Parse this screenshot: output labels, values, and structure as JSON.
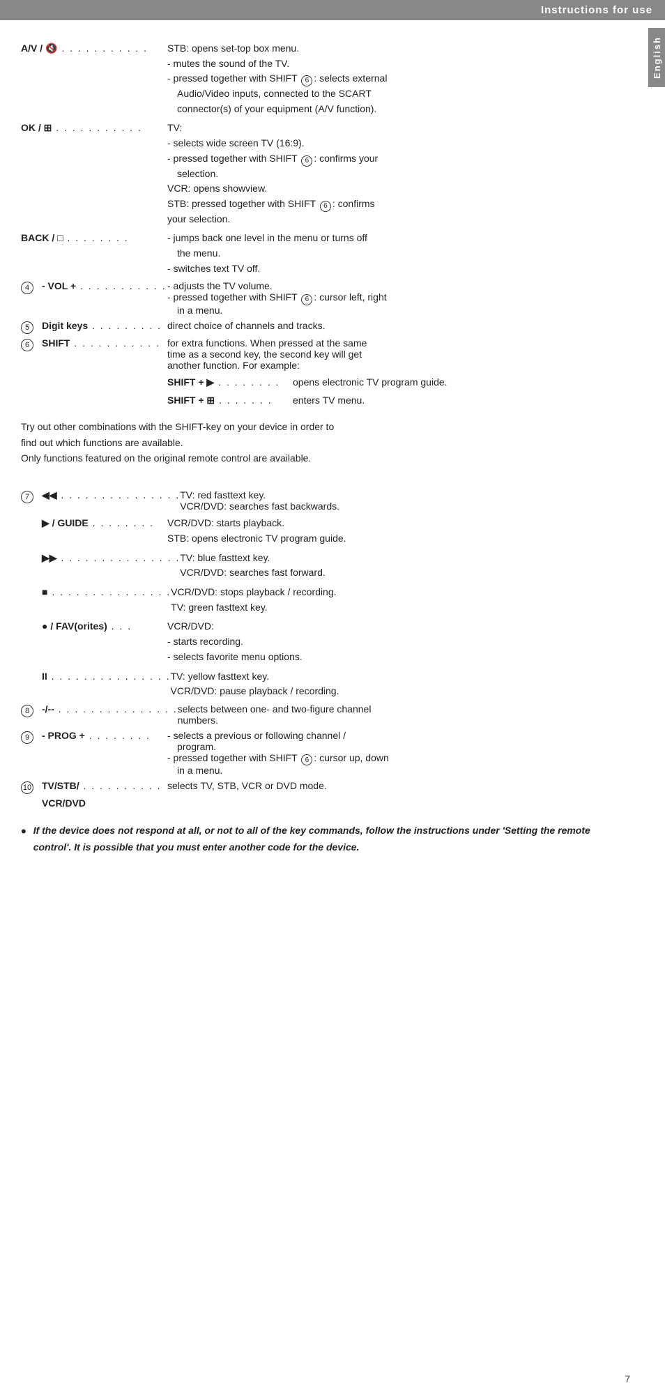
{
  "header": {
    "title": "Instructions for use",
    "side_tab": "English",
    "page_number": "7"
  },
  "entries": [
    {
      "id": "av",
      "key_label": "A/V / ",
      "key_icon": "🔇",
      "dots": " . . . . . . . . . . .",
      "values": [
        "STB: opens set-top box menu.",
        "- mutes the sound of the TV.",
        "- pressed together with SHIFT ⑥: selects external Audio/Video inputs, connected to the SCART connector(s) of your equipment (A/V function)."
      ]
    },
    {
      "id": "ok",
      "key_label": "OK / ",
      "key_icon": "⊞",
      "dots": " . . . . . . . . . . .",
      "values": [
        "TV:",
        "- selects wide screen TV (16:9).",
        "- pressed together with SHIFT ⑥: confirms your selection.",
        "VCR: opens showview.",
        "STB: pressed together with SHIFT ⑥: confirms your selection."
      ]
    },
    {
      "id": "back",
      "key_label": "BACK / □",
      "dots": " . . . . . . . .",
      "values": [
        "- jumps back one level in the menu or turns off the menu.",
        "- switches text TV off."
      ]
    },
    {
      "id": "vol",
      "num": "④",
      "key_label": "- VOL +",
      "dots": " . . . . . . . . . . .",
      "values": [
        "- adjusts the TV volume.",
        "- pressed together with SHIFT ⑥: cursor left, right in a menu."
      ]
    },
    {
      "id": "digit",
      "num": "⑤",
      "key_label": "Digit keys",
      "dots": " . . . . . . . . .",
      "values": [
        "direct choice of channels and tracks."
      ]
    },
    {
      "id": "shift",
      "num": "⑥",
      "key_label": "SHIFT",
      "dots": " . . . . . . . . . . .",
      "values": [
        "for extra functions. When pressed at the same time as a second key, the second key will get another function. For example:"
      ]
    }
  ],
  "shift_sub": [
    {
      "key": "SHIFT + ▶",
      "dots": " . . . . . . . .",
      "value": "opens electronic TV program guide."
    },
    {
      "key": "SHIFT + ⊞",
      "dots": " . . . . . . .",
      "value": "enters TV menu."
    }
  ],
  "paragraphs": [
    "Try out other combinations with the SHIFT-key on your device in order to find out which functions are available.",
    "Only functions featured on the original remote control are available."
  ],
  "transport_entries": [
    {
      "id": "rewind",
      "num": "⑦",
      "key_label": "◀◀",
      "dots": " . . . . . . . . . . . . . . .",
      "values": [
        "TV: red fasttext key.",
        "VCR/DVD: searches fast backwards."
      ]
    },
    {
      "id": "play_guide",
      "key_label": "▶ / GUIDE",
      "dots": " . . . . . . . .",
      "values": [
        "VCR/DVD: starts playback.",
        "STB: opens electronic TV program guide."
      ]
    },
    {
      "id": "ff",
      "key_label": "▶▶",
      "dots": " . . . . . . . . . . . . . . .",
      "values": [
        "TV: blue fasttext key.",
        "VCR/DVD: searches fast forward."
      ]
    },
    {
      "id": "stop",
      "key_label": "■",
      "dots": " . . . . . . . . . . . . . . .",
      "values": [
        "VCR/DVD: stops playback / recording.",
        "TV: green fasttext key."
      ]
    },
    {
      "id": "rec_fav",
      "key_label": "● / FAV(orites)",
      "dots": " . . .",
      "values": [
        "VCR/DVD:",
        "- starts recording.",
        "- selects favorite menu options."
      ]
    },
    {
      "id": "pause",
      "key_label": "II",
      "dots": " . . . . . . . . . . . . . . .",
      "values": [
        "TV: yellow fasttext key.",
        "VCR/DVD: pause playback / recording."
      ]
    },
    {
      "id": "ch_figure",
      "num": "⑧",
      "key_label": "-/--",
      "dots": " . . . . . . . . . . . . . . .",
      "values": [
        "selects between one- and two-figure channel numbers."
      ]
    },
    {
      "id": "prog",
      "num": "⑨",
      "key_label": "- PROG +",
      "dots": " . . . . . . . .",
      "values": [
        "- selects a previous or following channel / program.",
        "- pressed together with SHIFT ⑥: cursor up, down in a menu."
      ]
    },
    {
      "id": "tv_stb",
      "num": "⑩",
      "key_label": "TV/STB/",
      "key_label2": "VCR/DVD",
      "dots": " . . . . . . . . . .",
      "values": [
        "selects TV, STB, VCR or DVD mode."
      ]
    }
  ],
  "note": {
    "bullet": "•",
    "text": "If the device does not respond at all, or not to all of the key commands, follow the instructions under 'Setting the remote control'. It is possible that you must enter another code for the device."
  }
}
